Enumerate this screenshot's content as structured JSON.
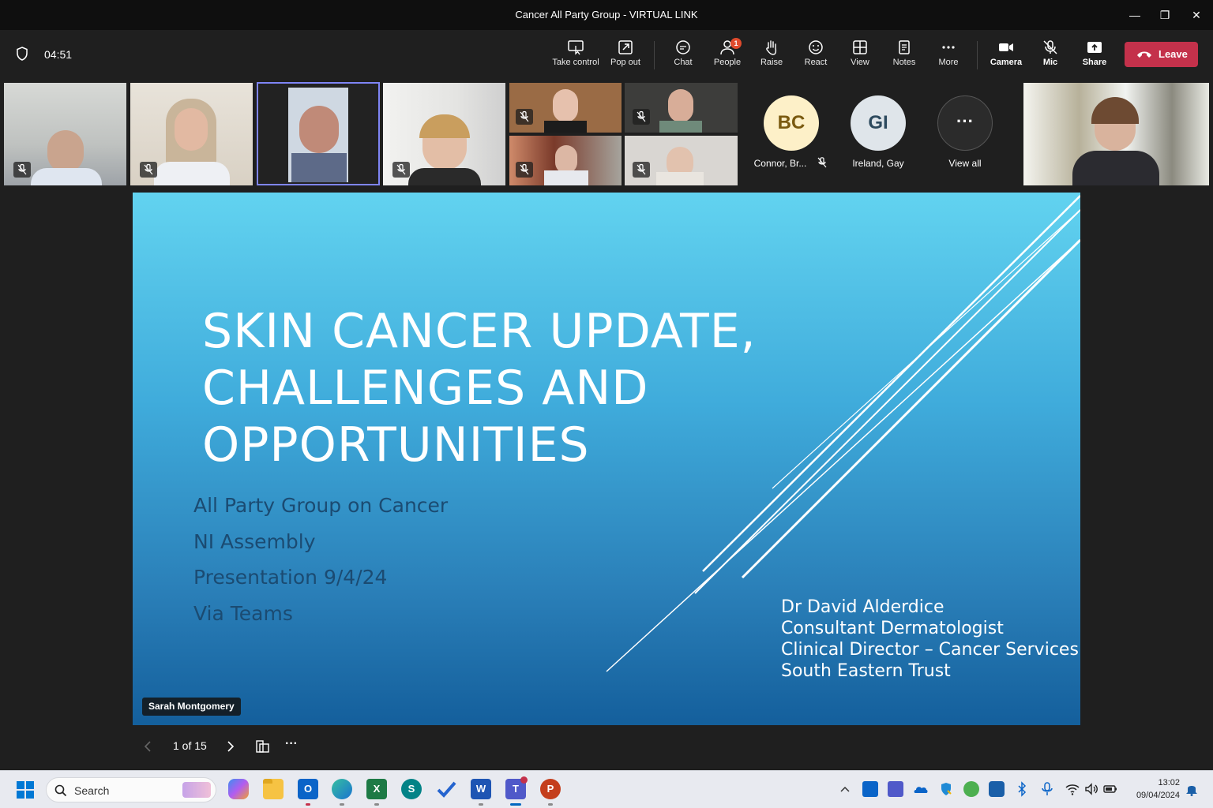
{
  "window": {
    "title": "Cancer All Party Group - VIRTUAL LINK",
    "minimize": "—",
    "restore": "❐",
    "close": "✕"
  },
  "toolbar": {
    "timer": "04:51",
    "take_control": "Take control",
    "pop_out": "Pop out",
    "chat": "Chat",
    "people": "People",
    "people_badge": "1",
    "raise": "Raise",
    "react": "React",
    "view": "View",
    "notes": "Notes",
    "more": "More",
    "camera": "Camera",
    "mic": "Mic",
    "share": "Share",
    "leave": "Leave"
  },
  "participants": {
    "avatars": [
      {
        "initials": "BC",
        "name": "Connor, Br...",
        "bg": "#fdf0c8",
        "fg": "#7a5a10"
      },
      {
        "initials": "GI",
        "name": "Ireland, Gay",
        "bg": "#dfe5ea",
        "fg": "#2d4a5e"
      }
    ],
    "view_all": "View all",
    "view_all_glyph": "···"
  },
  "slide": {
    "title_lines": [
      "SKIN CANCER UPDATE,",
      "CHALLENGES AND",
      "OPPORTUNITIES"
    ],
    "subtitle_lines": [
      "All Party Group on Cancer",
      "NI Assembly",
      "Presentation 9/4/24",
      "Via Teams"
    ],
    "presenter_lines": [
      "Dr David Alderdice",
      "Consultant Dermatologist",
      "Clinical Director – Cancer Services",
      "South Eastern Trust"
    ],
    "presenter_name": "Sarah Montgomery"
  },
  "slide_controls": {
    "page": "1 of 15",
    "more": "···"
  },
  "taskbar": {
    "search": "Search",
    "clock_time": "13:02",
    "clock_date": "09/04/2024"
  }
}
